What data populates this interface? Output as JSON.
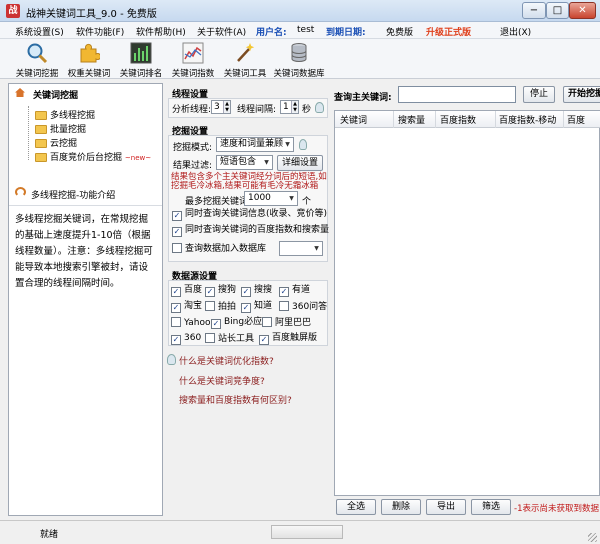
{
  "window": {
    "title": "战神关键词工具_9.0 - 免费版",
    "minimize": "−",
    "maximize": "□",
    "close": "✕"
  },
  "menu": {
    "items": [
      "系统设置(S)",
      "软件功能(F)",
      "软件帮助(H)",
      "关于软件(A)"
    ],
    "username_label": "用户名:",
    "username_value": "test",
    "expiry_label": "到期日期:",
    "expiry_value": "免费版",
    "upgrade": "升级正式版",
    "exit": "退出(X)"
  },
  "toolbar": [
    "关键词挖掘",
    "权重关键词",
    "关键词排名",
    "关键词指数",
    "关键词工具",
    "关键词数据库"
  ],
  "left": {
    "section_title": "关键词挖掘",
    "tree": [
      "多线程挖掘",
      "批量挖掘",
      "云挖掘",
      "百度竞价后台挖掘"
    ],
    "new_badge": "~new~",
    "intro_title": "多线程挖掘-功能介绍",
    "intro_text": "多线程挖掘关键词，在常规挖掘的基础上速度提升1-10倍（根据线程数量）。注意：多线程挖掘可能导致本地搜索引擎被封，请设置合理的线程间隔时间。"
  },
  "thread_settings": {
    "title": "线程设置",
    "threads_label": "分析线程:",
    "threads_value": "3",
    "interval_label": "线程间隔:",
    "interval_value": "1",
    "interval_unit": "秒"
  },
  "mining_settings": {
    "title": "挖掘设置",
    "mode_label": "挖掘模式:",
    "mode_value": "速度和词量兼顾",
    "filter_label": "结果过滤:",
    "filter_value": "短语包含",
    "filter_button": "详细设置",
    "warning": "结果包含多个主关键词经分词后的短语,如挖掘毛冷冰箱,结果可能有毛冷无霜冰箱",
    "max_label": "最多挖掘关键词:",
    "max_value": "1000",
    "max_unit": "个",
    "options": [
      {
        "label": "同时查询关键词信息(收录、竞价等)",
        "checked": true
      },
      {
        "label": "同时查询关键词的百度指数和搜索量",
        "checked": true
      },
      {
        "label": "查询数据加入数据库",
        "checked": false
      }
    ]
  },
  "datasource": {
    "title": "数据源设置",
    "rows": [
      [
        {
          "label": "百度",
          "checked": true
        },
        {
          "label": "搜狗",
          "checked": true
        },
        {
          "label": "搜搜",
          "checked": true
        },
        {
          "label": "有道",
          "checked": true
        }
      ],
      [
        {
          "label": "淘宝",
          "checked": true
        },
        {
          "label": "拍拍",
          "checked": false
        },
        {
          "label": "知道",
          "checked": true
        },
        {
          "label": "360问答",
          "checked": false
        }
      ],
      [
        {
          "label": "Yahoo",
          "checked": false
        },
        {
          "label": "Bing必应",
          "checked": true
        },
        {
          "label": "阿里巴巴",
          "checked": false
        }
      ],
      [
        {
          "label": "360",
          "checked": true
        },
        {
          "label": "站长工具",
          "checked": false
        },
        {
          "label": "百度触屏版",
          "checked": true
        }
      ]
    ]
  },
  "help_links": [
    "什么是关键词优化指数?",
    "什么是关键词竞争度?",
    "搜索量和百度指数有何区别?"
  ],
  "query": {
    "label": "查询主关键词:",
    "input_value": "",
    "stop_button": "停止",
    "start_button": "开始挖掘",
    "columns": [
      "关键词",
      "搜索量",
      "百度指数",
      "百度指数-移动",
      "百度"
    ],
    "actions": [
      "全选",
      "删除",
      "导出",
      "筛选"
    ],
    "note": "-1表示尚未获取到数据"
  },
  "status": {
    "text": "就绪"
  }
}
